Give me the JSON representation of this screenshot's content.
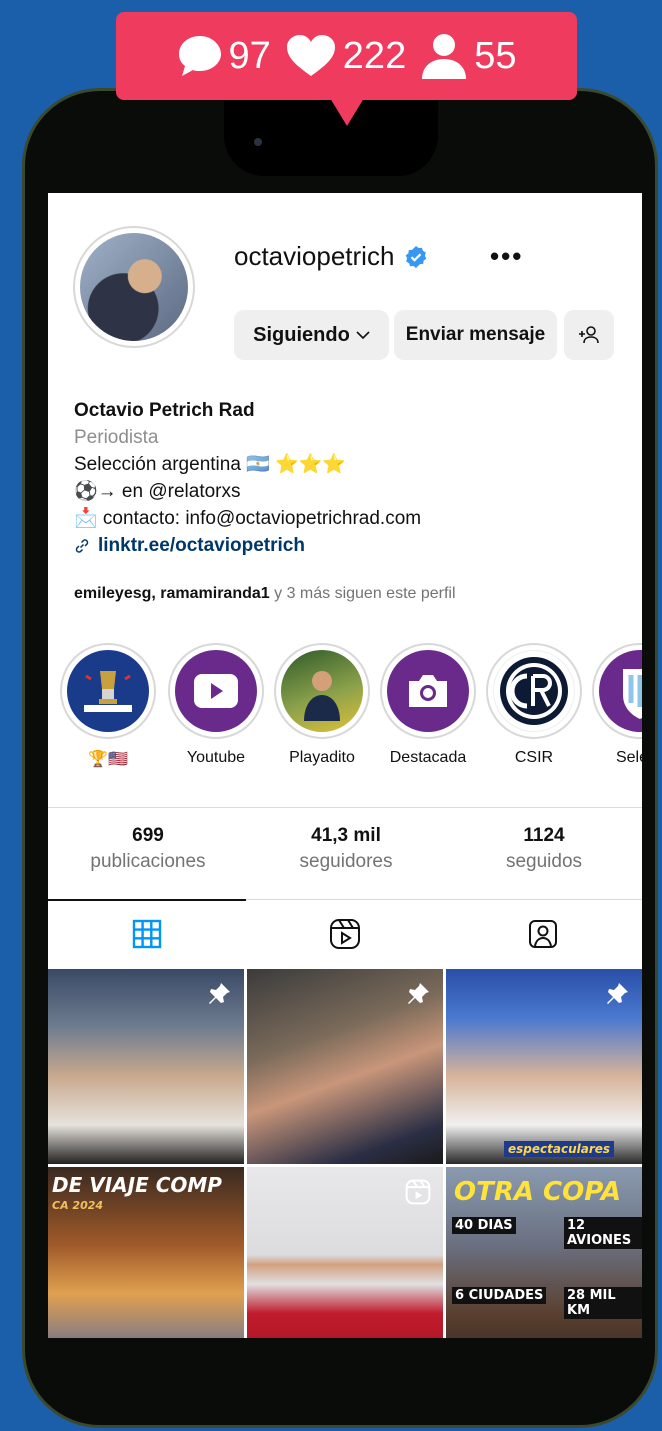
{
  "notification": {
    "comments": "97",
    "likes": "222",
    "followers": "55",
    "color": "#ee3b5e"
  },
  "profile": {
    "username": "octaviopetrich",
    "more_label": "•••",
    "follow_button": "Siguiendo",
    "message_button": "Enviar mensaje",
    "add_person_label": "+ዖ",
    "display_name": "Octavio Petrich Rad",
    "category": "Periodista",
    "bio_lines": [
      "Selección argentina 🇦🇷 ⭐⭐⭐",
      "⚽→ en @relatorxs",
      "📩 contacto: info@octaviopetrichrad.com"
    ],
    "link": "linktr.ee/octaviopetrich",
    "followed_by_names": "emileyesg, ramamiranda1",
    "followed_by_rest": " y 3 más siguen este perfil"
  },
  "highlights": [
    {
      "label": "🏆🇺🇸",
      "icon": "copa-america-logo"
    },
    {
      "label": "Youtube",
      "icon": "play-icon"
    },
    {
      "label": "Playadito",
      "icon": "photo-thumbnail"
    },
    {
      "label": "Destacada",
      "icon": "camera-icon"
    },
    {
      "label": "CSIR",
      "icon": "csir-crest"
    },
    {
      "label": "Selecc",
      "icon": "afa-crest"
    }
  ],
  "stats": [
    {
      "num": "699",
      "label": "publicaciones"
    },
    {
      "num": "41,3 mil",
      "label": "seguidores"
    },
    {
      "num": "1124",
      "label": "seguidos"
    }
  ],
  "tabs": [
    "grid-icon",
    "reels-icon",
    "tagged-icon"
  ],
  "posts": [
    {
      "caption": "",
      "badge": "pin-icon"
    },
    {
      "caption": "",
      "badge": "pin-icon"
    },
    {
      "caption": "espectaculares",
      "badge": "pin-icon"
    },
    {
      "caption": "DE VIAJE COMP",
      "sub": "CA 2024",
      "badge": ""
    },
    {
      "caption": "",
      "badge": "reels-icon"
    },
    {
      "caption": "OTRA COPA",
      "tags": [
        "40 DIAS",
        "12 AVIONES",
        "6 CIUDADES",
        "28 MIL KM"
      ],
      "badge": ""
    }
  ],
  "colors": {
    "background": "#1b5faa",
    "link": "#00376b",
    "verified": "#3897f0",
    "highlight_purple": "#6a2a8c"
  }
}
